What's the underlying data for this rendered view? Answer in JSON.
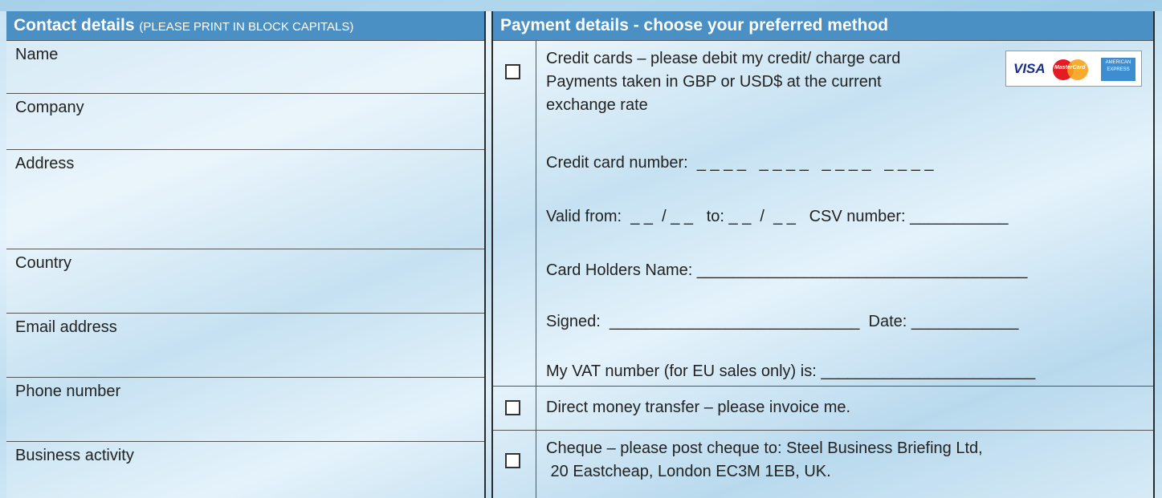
{
  "contact": {
    "heading": "Contact details",
    "subheading": "(PLEASE PRINT IN BLOCK CAPITALS)",
    "fields": [
      "Name",
      "Company",
      "Address",
      "Country",
      "Email address",
      "Phone number",
      "Business activity"
    ]
  },
  "payment": {
    "heading": "Payment details - choose your preferred method",
    "credit": {
      "line1": "Credit cards – please debit my credit/ charge card",
      "line2": "Payments taken in GBP or USD$ at the current",
      "line3": "exchange rate",
      "card_number": "Credit card number:  _ _ _ _   _ _ _ _   _ _ _ _   _ _ _ _",
      "valid": "Valid from:  _ _  / _ _   to: _ _  /  _ _   CSV number: ___________",
      "holder": "Card Holders Name: _____________________________________",
      "signed": "Signed:  ____________________________  Date: ____________",
      "vat": "My VAT number (for EU sales only) is: ________________________",
      "logos": {
        "visa": "VISA",
        "mastercard": "MasterCard",
        "amex_line1": "AMERICAN",
        "amex_line2": "EXPRESS"
      }
    },
    "transfer": "Direct money transfer – please invoice me.",
    "cheque": {
      "line1": "Cheque – please post cheque to: Steel Business Briefing Ltd,",
      "line2": " 20 Eastcheap, London EC3M 1EB, UK."
    }
  },
  "colors": {
    "header_blue": "#4a90c4",
    "background_light_blue": "#cfe7f5"
  }
}
